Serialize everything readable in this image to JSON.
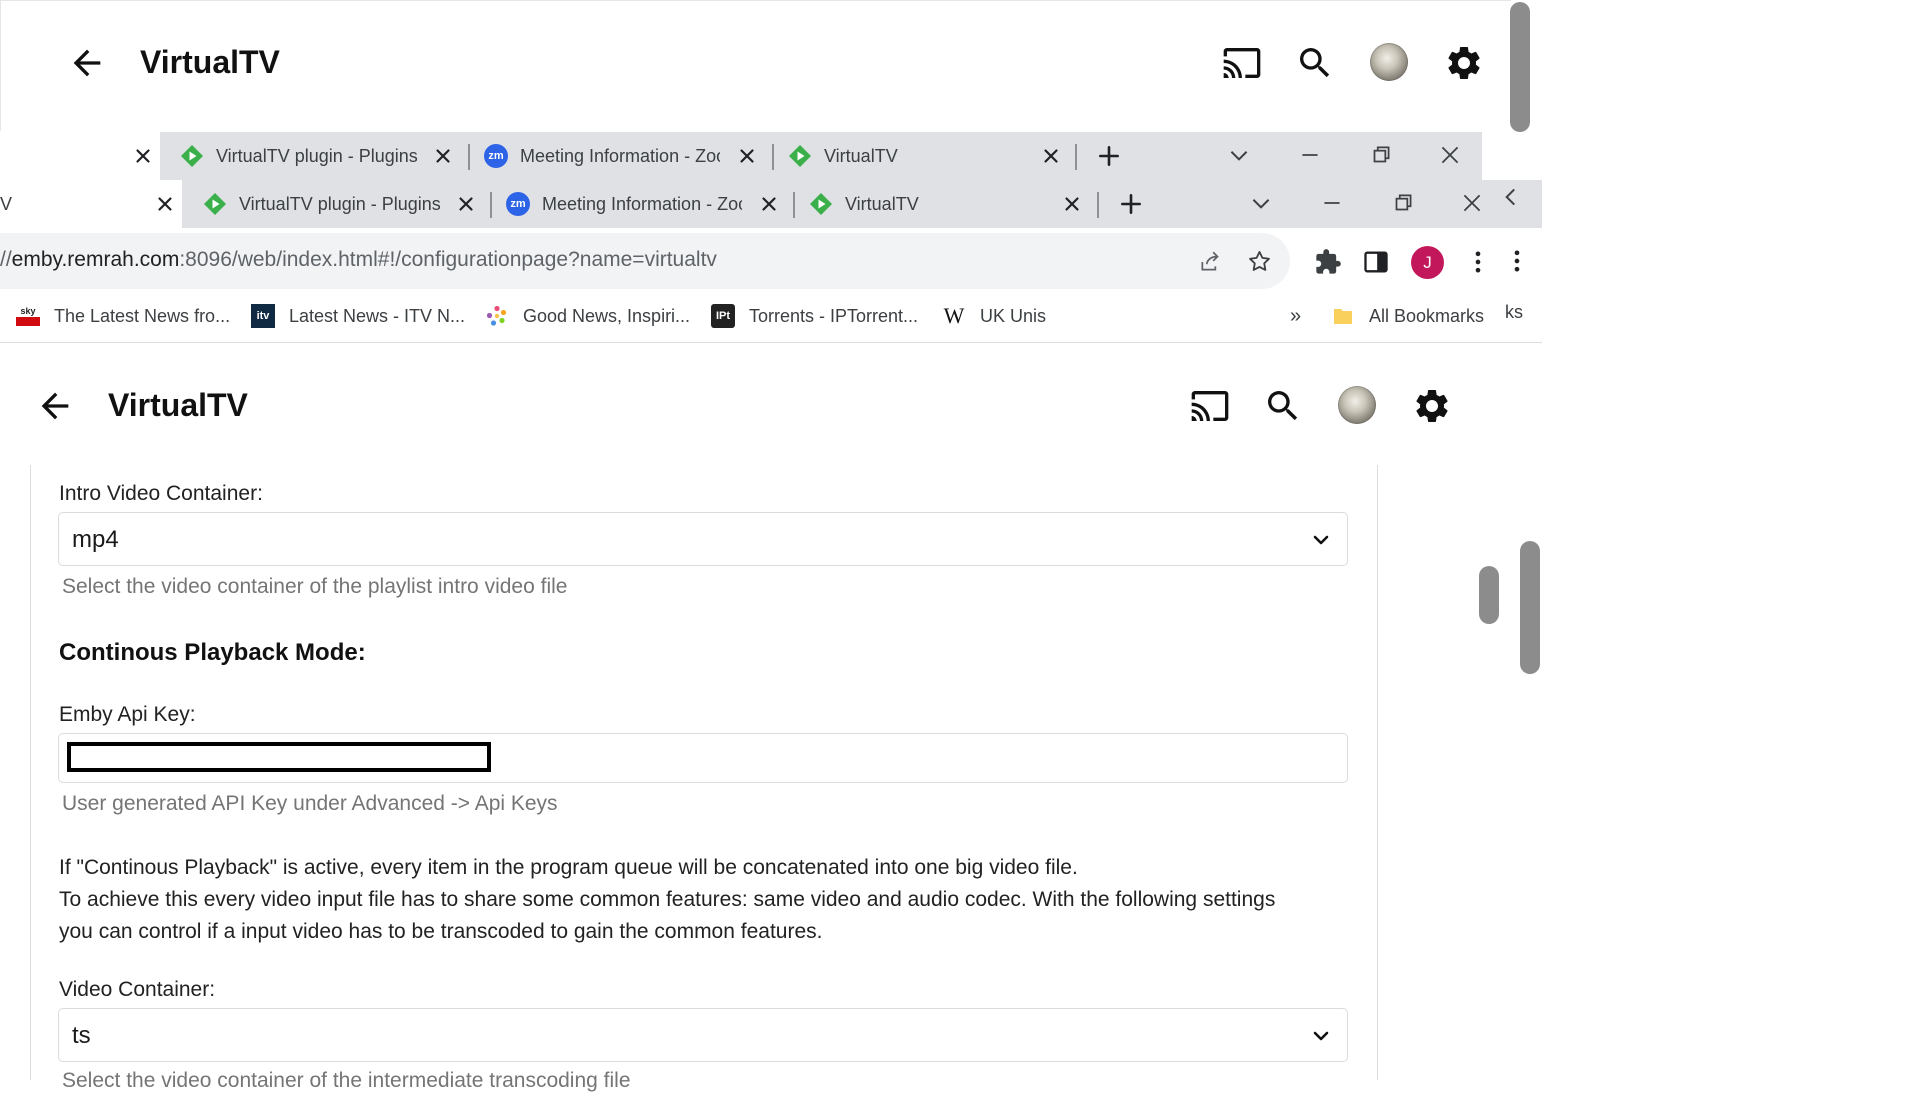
{
  "app": {
    "title": "VirtualTV"
  },
  "tab_strip_1": {
    "tabs": [
      {
        "label": "",
        "icon": "none"
      },
      {
        "label": "VirtualTV plugin - Plugins",
        "icon": "virtualtv-favicon"
      },
      {
        "label": "Meeting Information - Zoom",
        "icon": "zoom-favicon"
      },
      {
        "label": "VirtualTV",
        "icon": "virtualtv-favicon"
      }
    ]
  },
  "tab_strip_2": {
    "left_fragment": "V",
    "tabs": [
      {
        "label": "VirtualTV plugin - Plugins",
        "icon": "virtualtv-favicon"
      },
      {
        "label": "Meeting Information - Zoom",
        "icon": "zoom-favicon"
      },
      {
        "label": "VirtualTV",
        "icon": "virtualtv-favicon"
      }
    ]
  },
  "addressbar": {
    "url_prefix": "//",
    "url_host": "emby.remrah.com",
    "url_rest": ":8096/web/index.html#!/configurationpage?name=virtualtv",
    "profile_initial": "J"
  },
  "bookmarks": {
    "items": [
      {
        "label": "The Latest News fro...",
        "icon": "sky-news-icon"
      },
      {
        "label": "Latest News - ITV N...",
        "icon": "itv-icon"
      },
      {
        "label": "Good News, Inspiri...",
        "icon": "flower-icon"
      },
      {
        "label": "Torrents - IPTorrent...",
        "icon": "iptorrents-icon"
      },
      {
        "label": "UK Unis",
        "icon": "wikipedia-icon"
      }
    ],
    "overflow": "»",
    "all_bookmarks": "All Bookmarks",
    "trailing_fragment": "ks"
  },
  "form": {
    "intro_container": {
      "label": "Intro Video Container:",
      "value": "mp4",
      "hint": "Select the video container of the playlist intro video file"
    },
    "continuous_heading": "Continous Playback Mode:",
    "api_key": {
      "label": "Emby Api Key:",
      "hint": "User generated API Key under Advanced -> Api Keys"
    },
    "paragraph": {
      "line1": "If \"Continous Playback\" is active, every item in the program queue will be concatenated into one big video file.",
      "line2": "To achieve this every video input file has to share some common features: same video and audio codec. With the following settings",
      "line3": "you can control if a input video has to be transcoded to gain the common features."
    },
    "video_container": {
      "label": "Video Container:",
      "value": "ts",
      "hint": "Select the video container of the intermediate transcoding file"
    }
  },
  "colors": {
    "tab_strip": "#dfe1e5",
    "address_bar": "#f1f3f4",
    "profile": "#c2185b",
    "zoom": "#2d63e6",
    "virtualtv_green": "#3bb04a",
    "hint_text": "#757575",
    "scrollbar": "#8c8c8c"
  }
}
